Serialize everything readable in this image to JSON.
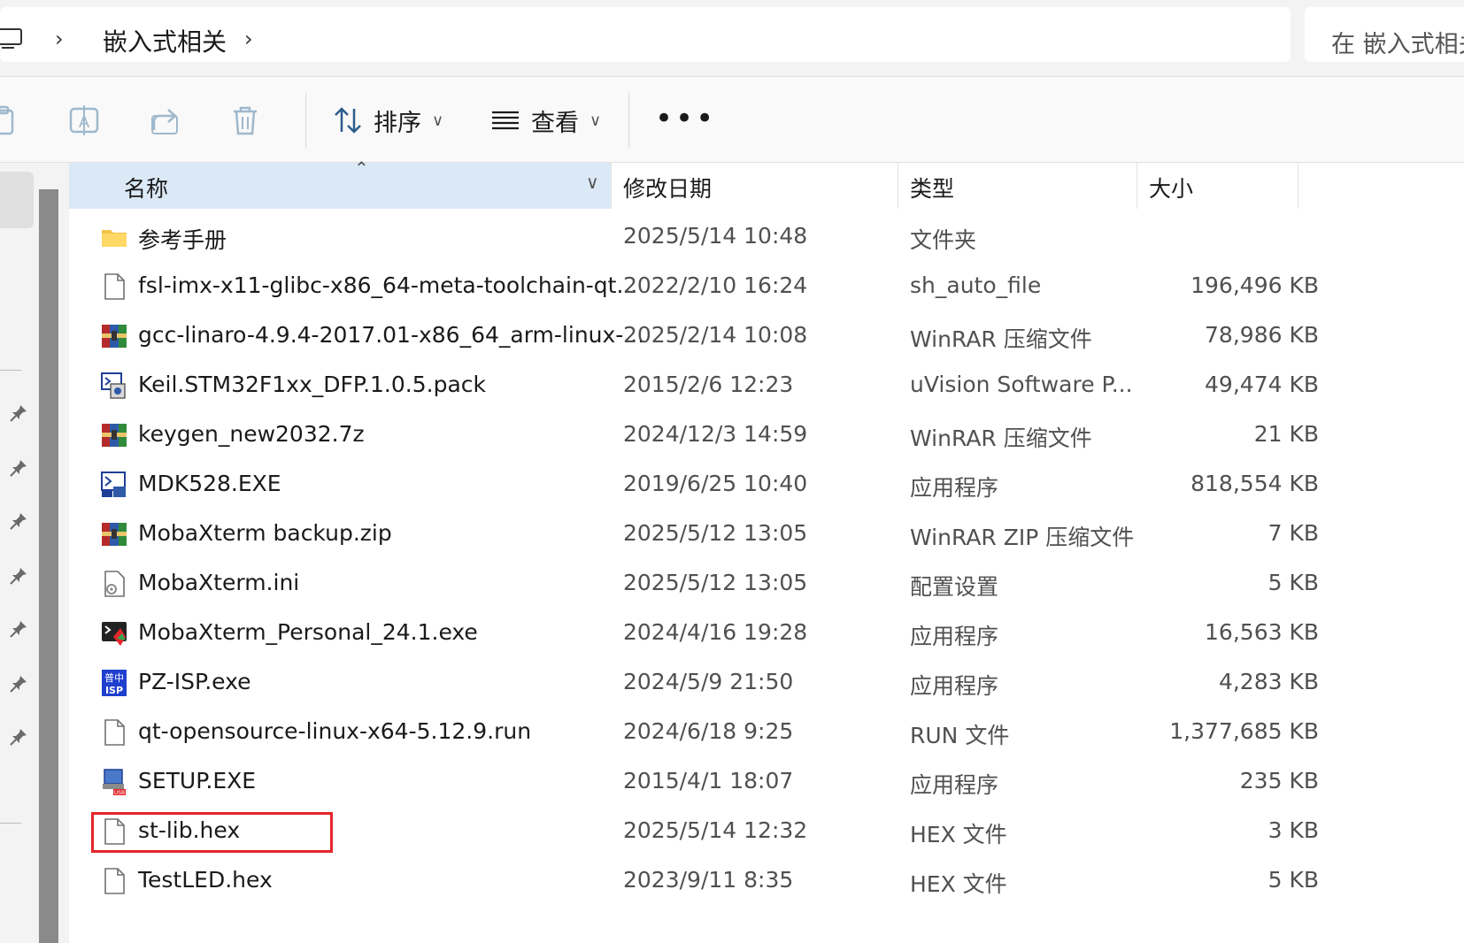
{
  "address": {
    "breadcrumb": [
      "嵌入式相关"
    ],
    "search_placeholder": "在 嵌入式相关"
  },
  "toolbar": {
    "sort_label": "排序",
    "view_label": "查看",
    "more_label": "•••"
  },
  "columns": {
    "name": "名称",
    "date": "修改日期",
    "type": "类型",
    "size": "大小"
  },
  "files": [
    {
      "icon": "folder-icon",
      "name": "参考手册",
      "date": "2025/5/14 10:48",
      "type": "文件夹",
      "size": ""
    },
    {
      "icon": "generic-file-icon",
      "name": "fsl-imx-x11-glibc-x86_64-meta-toolchain-qt...",
      "date": "2022/2/10 16:24",
      "type": "sh_auto_file",
      "size": "196,496 KB"
    },
    {
      "icon": "winrar-icon",
      "name": "gcc-linaro-4.9.4-2017.01-x86_64_arm-linux-...",
      "date": "2025/2/14 10:08",
      "type": "WinRAR 压缩文件",
      "size": "78,986 KB"
    },
    {
      "icon": "keil-pack-icon",
      "name": "Keil.STM32F1xx_DFP.1.0.5.pack",
      "date": "2015/2/6 12:23",
      "type": "uVision Software P...",
      "size": "49,474 KB"
    },
    {
      "icon": "winrar-icon",
      "name": "keygen_new2032.7z",
      "date": "2024/12/3 14:59",
      "type": "WinRAR 压缩文件",
      "size": "21 KB"
    },
    {
      "icon": "keil-exe-icon",
      "name": "MDK528.EXE",
      "date": "2019/6/25 10:40",
      "type": "应用程序",
      "size": "818,554 KB"
    },
    {
      "icon": "winrar-icon",
      "name": "MobaXterm backup.zip",
      "date": "2025/5/12 13:05",
      "type": "WinRAR ZIP 压缩文件",
      "size": "7 KB"
    },
    {
      "icon": "settings-file-icon",
      "name": "MobaXterm.ini",
      "date": "2025/5/12 13:05",
      "type": "配置设置",
      "size": "5 KB"
    },
    {
      "icon": "mobaxterm-icon",
      "name": "MobaXterm_Personal_24.1.exe",
      "date": "2024/4/16 19:28",
      "type": "应用程序",
      "size": "16,563 KB"
    },
    {
      "icon": "pz-isp-icon",
      "name": "PZ-ISP.exe",
      "date": "2024/5/9 21:50",
      "type": "应用程序",
      "size": "4,283 KB"
    },
    {
      "icon": "generic-file-icon",
      "name": "qt-opensource-linux-x64-5.12.9.run",
      "date": "2024/6/18 9:25",
      "type": "RUN 文件",
      "size": "1,377,685 KB"
    },
    {
      "icon": "setup-usb-icon",
      "name": "SETUP.EXE",
      "date": "2015/4/1 18:07",
      "type": "应用程序",
      "size": "235 KB"
    },
    {
      "icon": "generic-file-icon",
      "name": "st-lib.hex",
      "date": "2025/5/14 12:32",
      "type": "HEX 文件",
      "size": "3 KB"
    },
    {
      "icon": "generic-file-icon",
      "name": "TestLED.hex",
      "date": "2023/9/11 8:35",
      "type": "HEX 文件",
      "size": "5 KB"
    }
  ],
  "highlighted_file": "st-lib.hex",
  "colors": {
    "header_selected": "#dbe9f7",
    "highlight_box": "#e4252c",
    "folder": "#f4c44a"
  }
}
